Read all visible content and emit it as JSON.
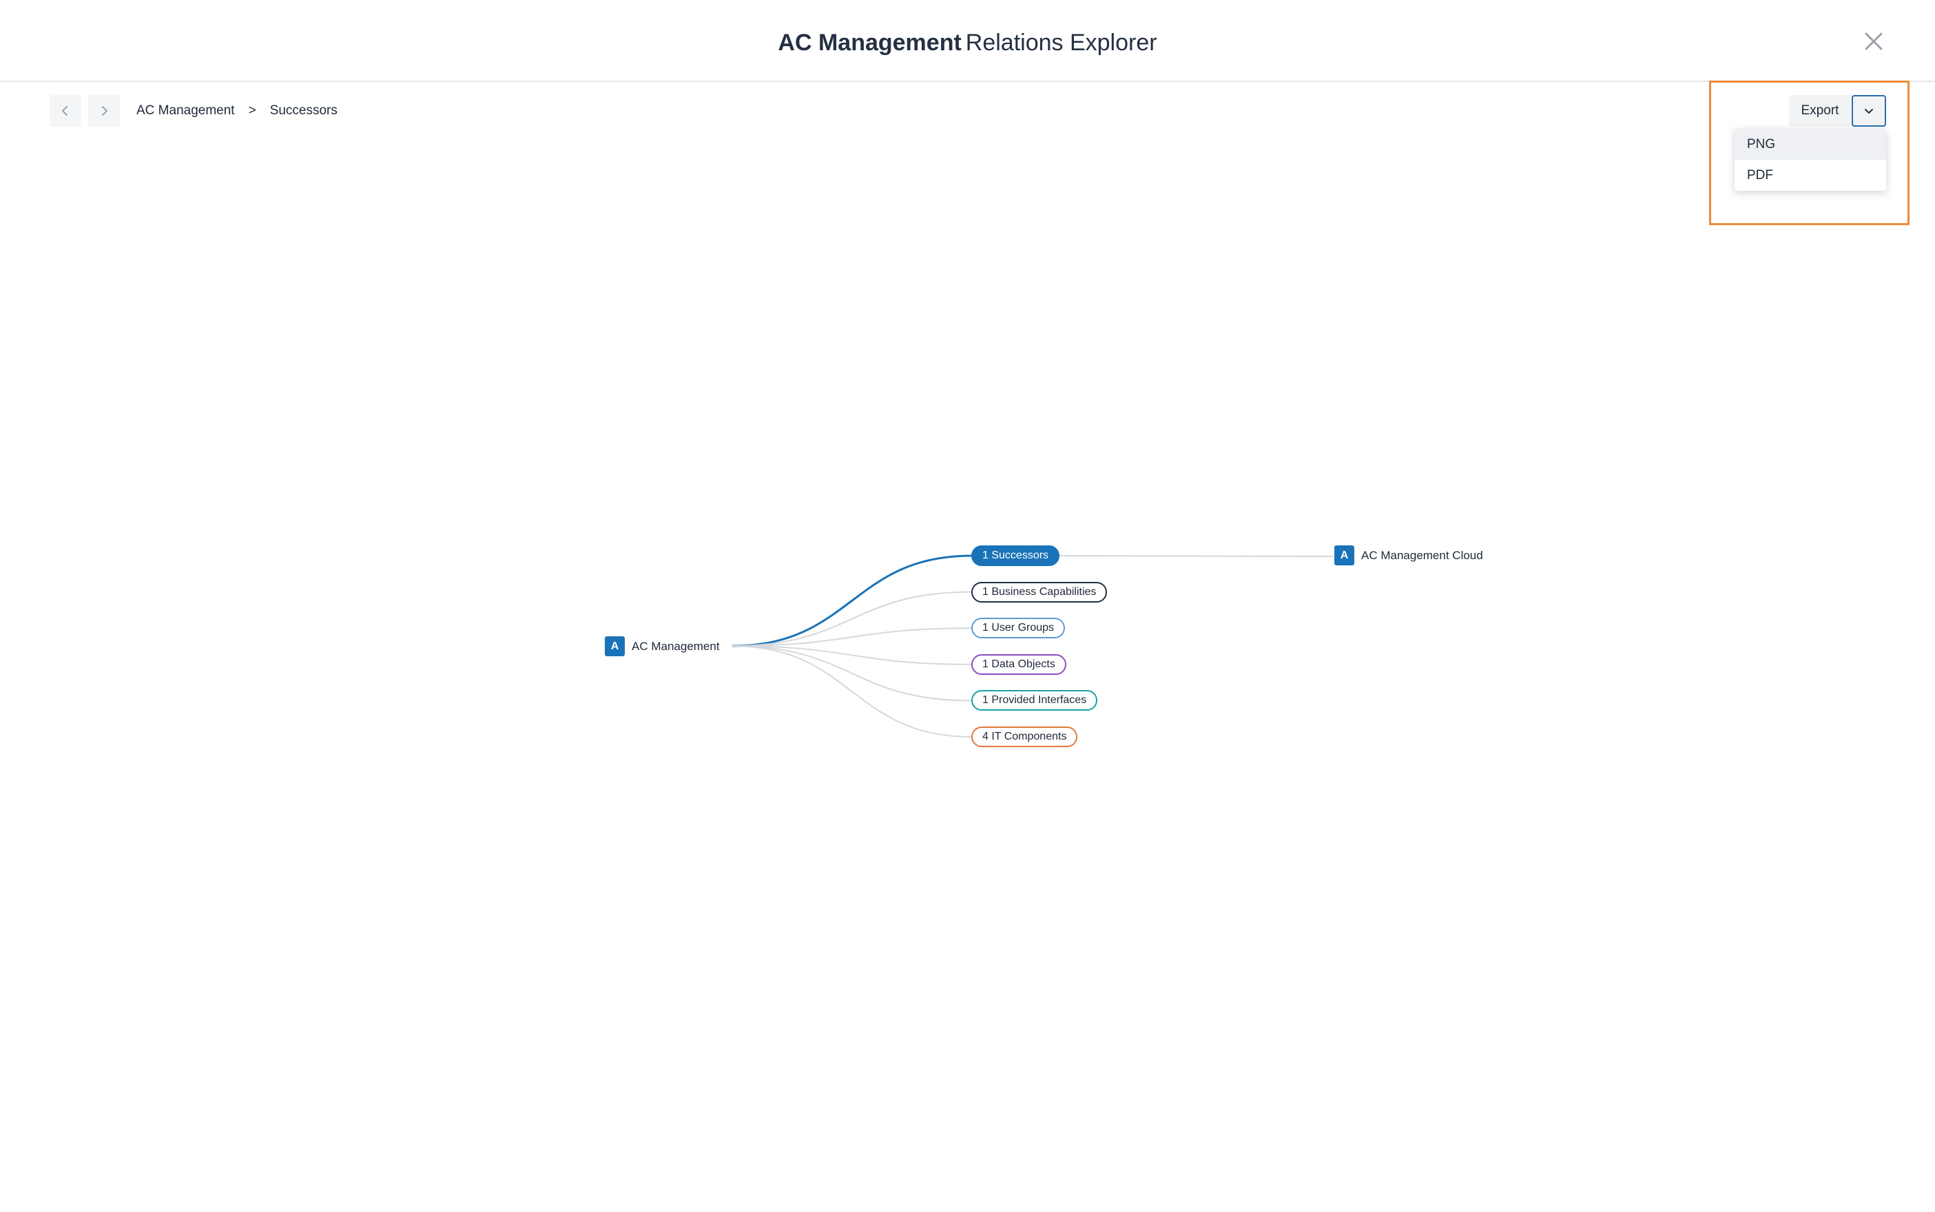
{
  "header": {
    "title_strong": "AC Management",
    "title_light": "Relations Explorer",
    "close_icon": "close-icon"
  },
  "toolbar": {
    "back_icon": "chevron-left-icon",
    "forward_icon": "chevron-right-icon",
    "breadcrumb": [
      "AC Management",
      ">",
      "Successors"
    ]
  },
  "export": {
    "label": "Export",
    "toggle_icon": "chevron-down-icon",
    "options": [
      "PNG",
      "PDF"
    ],
    "highlight_color": "#ee8b3a"
  },
  "graph": {
    "root": {
      "badge": "A",
      "label": "AC Management"
    },
    "categories": [
      {
        "label": "1 Successors",
        "color": "#1a73b8",
        "active": true
      },
      {
        "label": "1 Business Capabilities",
        "color": "#253042",
        "active": false
      },
      {
        "label": "1 User Groups",
        "color": "#5b9bd5",
        "active": false
      },
      {
        "label": "1 Data Objects",
        "color": "#8a4fc2",
        "active": false
      },
      {
        "label": "1 Provided Interfaces",
        "color": "#1aa3a3",
        "active": false
      },
      {
        "label": "4 IT Components",
        "color": "#e07b3a",
        "active": false
      }
    ],
    "target": {
      "badge": "A",
      "label": "AC Management Cloud"
    }
  }
}
